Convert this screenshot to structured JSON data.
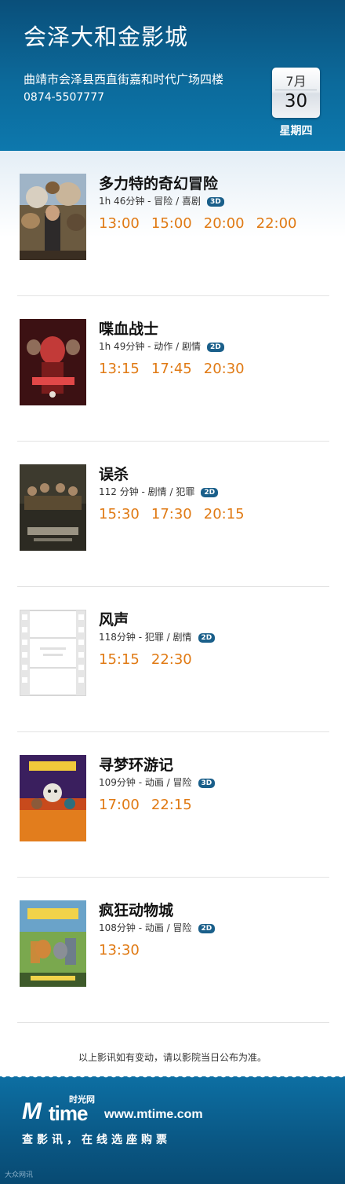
{
  "cinema": {
    "name": "会泽大和金影城",
    "address": "曲靖市会泽县西直街嘉和时代广场四楼",
    "phone": "0874-5507777"
  },
  "date": {
    "month": "7月",
    "day": "30",
    "weekday": "星期四"
  },
  "movies": [
    {
      "title": "多力特的奇幻冒险",
      "meta": "1h 46分钟 - 冒险 / 喜剧",
      "format": "3D",
      "times": [
        "13:00",
        "15:00",
        "20:00",
        "22:00"
      ]
    },
    {
      "title": "喋血战士",
      "meta": "1h 49分钟 - 动作 / 剧情",
      "format": "2D",
      "times": [
        "13:15",
        "17:45",
        "20:30"
      ]
    },
    {
      "title": "误杀",
      "meta": "112 分钟 - 剧情 / 犯罪",
      "format": "2D",
      "times": [
        "15:30",
        "17:30",
        "20:15"
      ]
    },
    {
      "title": "风声",
      "meta": "118分钟 - 犯罪 / 剧情",
      "format": "2D",
      "times": [
        "15:15",
        "22:30"
      ]
    },
    {
      "title": "寻梦环游记",
      "meta": "109分钟 - 动画 / 冒险",
      "format": "3D",
      "times": [
        "17:00",
        "22:15"
      ]
    },
    {
      "title": "疯狂动物城",
      "meta": "108分钟 - 动画 / 冒险",
      "format": "2D",
      "times": [
        "13:30"
      ]
    }
  ],
  "notice": "以上影讯如有变动，请以影院当日公布为准。",
  "footer": {
    "logo_m": "M",
    "logo_time": "time",
    "logo_cn": "时光网",
    "site": "www.mtime.com",
    "slogan": "查影讯，在线选座购票",
    "watermark": "大众网讯"
  },
  "colors": {
    "header_blue": "#0c6a9b",
    "showtime_orange": "#e07a14",
    "badge_blue": "#1a5f8a"
  }
}
